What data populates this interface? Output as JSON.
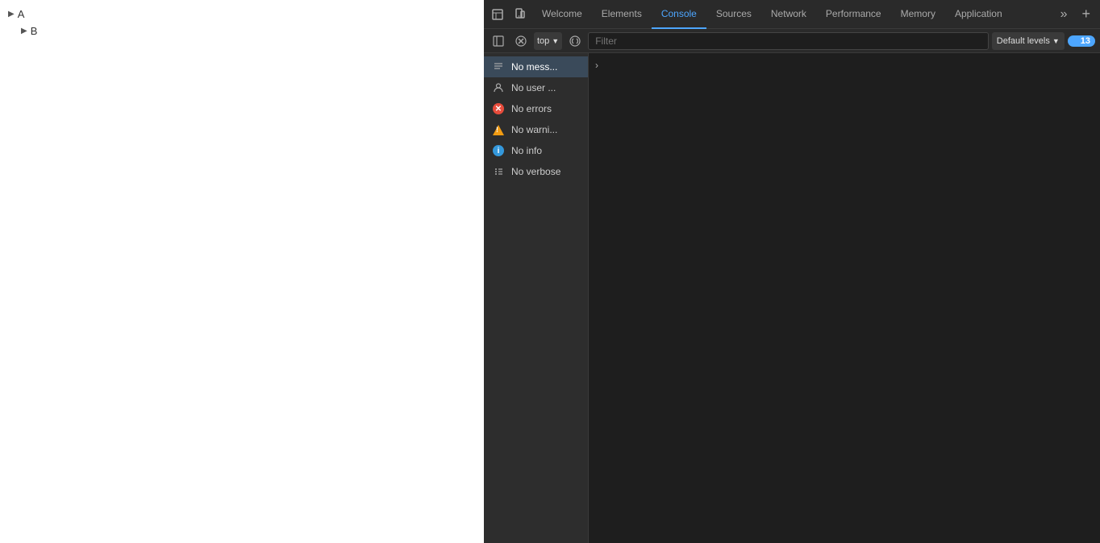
{
  "page": {
    "tree": {
      "item_a": "A",
      "item_b": "B"
    }
  },
  "devtools": {
    "tabs": [
      {
        "label": "Welcome",
        "active": false
      },
      {
        "label": "Elements",
        "active": false
      },
      {
        "label": "Console",
        "active": true
      },
      {
        "label": "Sources",
        "active": false
      },
      {
        "label": "Network",
        "active": false
      },
      {
        "label": "Performance",
        "active": false
      },
      {
        "label": "Memory",
        "active": false
      },
      {
        "label": "Application",
        "active": false
      }
    ],
    "toolbar": {
      "top_label": "top",
      "filter_placeholder": "Filter",
      "default_levels_label": "Default levels",
      "badge_count": "13"
    },
    "console_menu": [
      {
        "label": "No mess...",
        "icon": "messages",
        "selected": true
      },
      {
        "label": "No user ...",
        "icon": "user",
        "selected": false
      },
      {
        "label": "No errors",
        "icon": "error",
        "selected": false
      },
      {
        "label": "No warni...",
        "icon": "warning",
        "selected": false
      },
      {
        "label": "No info",
        "icon": "info",
        "selected": false
      },
      {
        "label": "No verbose",
        "icon": "verbose",
        "selected": false
      }
    ]
  }
}
